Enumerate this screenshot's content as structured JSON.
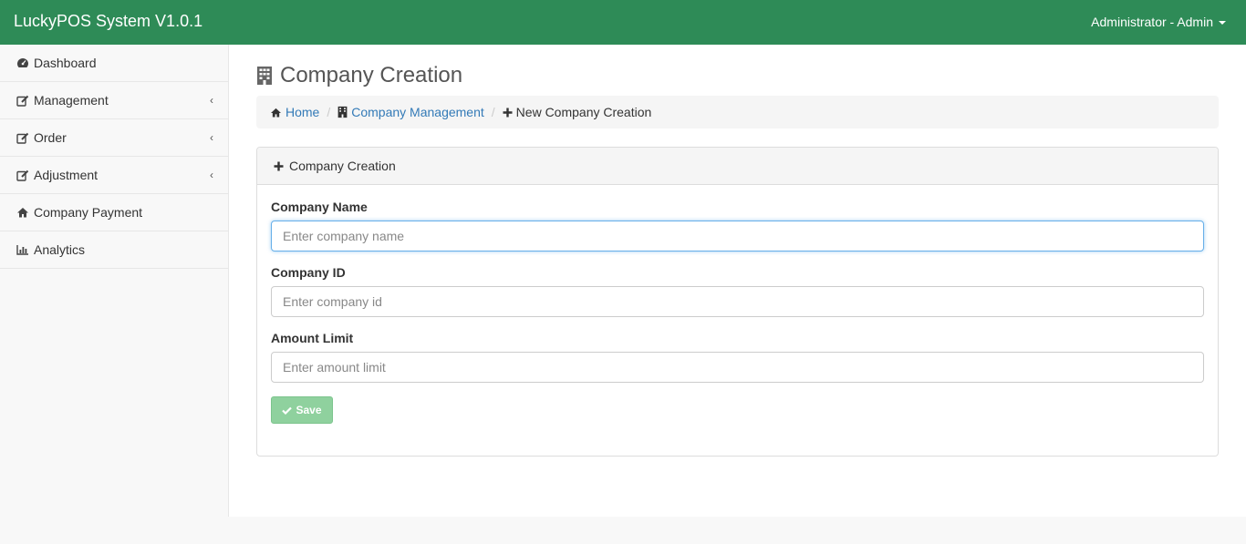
{
  "app": {
    "brand": "LuckyPOS System V1.0.1",
    "user_menu": "Administrator - Admin"
  },
  "colors": {
    "topbar": "#2e8b57",
    "link": "#337ab7",
    "save_button": "#8fd19e"
  },
  "sidebar": {
    "items": [
      {
        "label": "Dashboard",
        "icon": "dashboard-icon",
        "has_submenu": false
      },
      {
        "label": "Management",
        "icon": "edit-icon",
        "has_submenu": true
      },
      {
        "label": "Order",
        "icon": "edit-icon",
        "has_submenu": true
      },
      {
        "label": "Adjustment",
        "icon": "edit-icon",
        "has_submenu": true
      },
      {
        "label": "Company Payment",
        "icon": "home-icon",
        "has_submenu": false
      },
      {
        "label": "Analytics",
        "icon": "bar-chart-icon",
        "has_submenu": false
      }
    ],
    "chevron": "‹"
  },
  "page": {
    "title": "Company Creation"
  },
  "breadcrumb": {
    "home": "Home",
    "company_management": "Company Management",
    "current": "New Company Creation",
    "separator": "/"
  },
  "panel": {
    "heading": "Company Creation"
  },
  "form": {
    "company_name": {
      "label": "Company Name",
      "placeholder": "Enter company name",
      "value": ""
    },
    "company_id": {
      "label": "Company ID",
      "placeholder": "Enter company id",
      "value": ""
    },
    "amount_limit": {
      "label": "Amount Limit",
      "placeholder": "Enter amount limit",
      "value": ""
    },
    "save_label": "Save"
  }
}
